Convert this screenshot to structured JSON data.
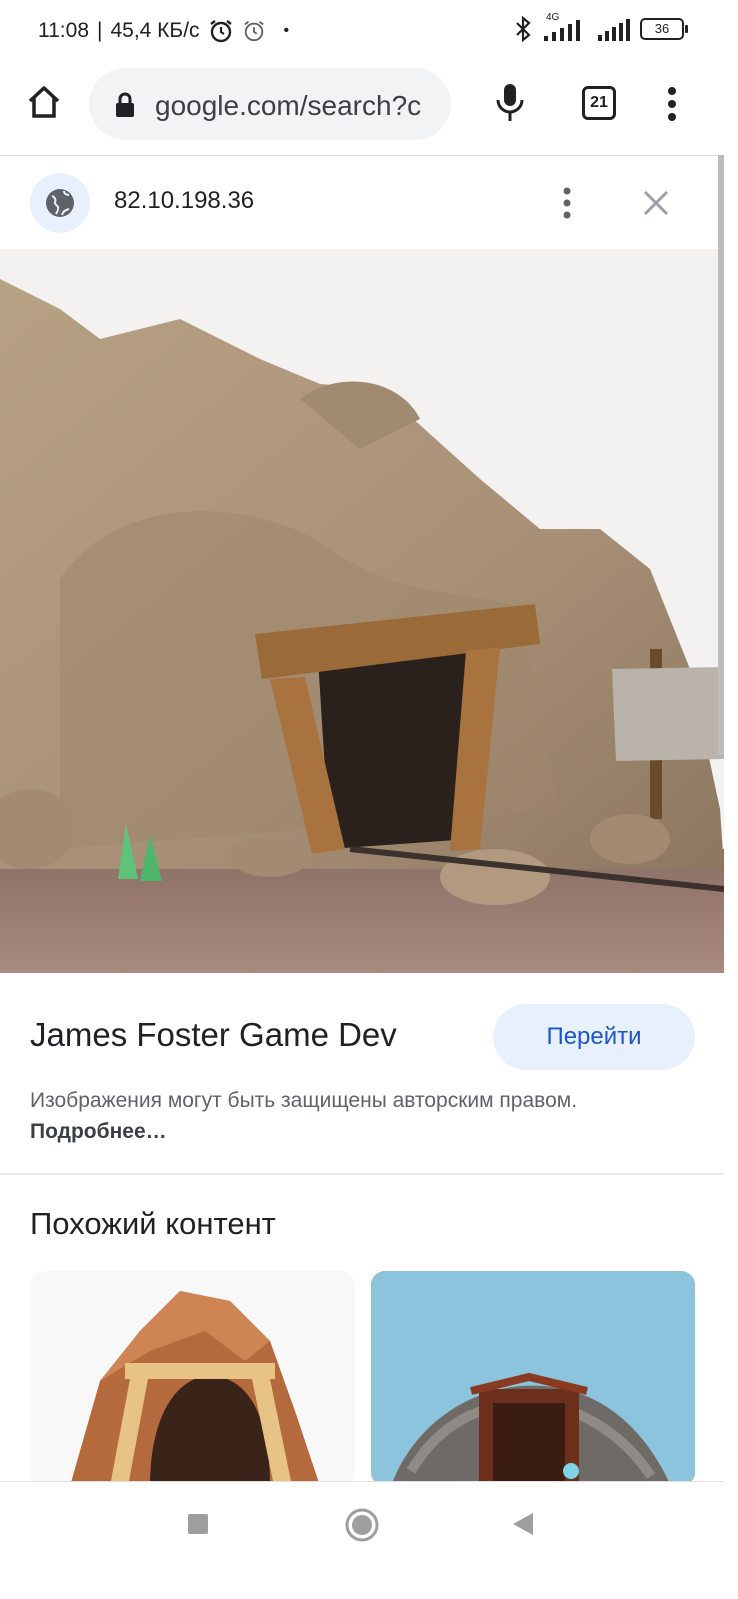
{
  "status_bar": {
    "time": "11:08",
    "separator": "|",
    "speed": "45,4 КБ/с",
    "dot": "•",
    "network": "4G",
    "battery": "36"
  },
  "toolbar": {
    "url": "google.com/search?c",
    "tab_count": "21"
  },
  "site_bar": {
    "address": "82.10.198.36"
  },
  "result": {
    "source_name": "James Foster Game Dev",
    "visit_label": "Перейти",
    "copyright_text": "Изображения могут быть защищены авторским правом.",
    "more_link": "Подробнее…"
  },
  "similar": {
    "title": "Похожий контент"
  },
  "colors": {
    "accent": "#1a56c5",
    "pill": "#e8f0fe",
    "url_bg": "#f1f3f4"
  },
  "icons": [
    "home-icon",
    "lock-icon",
    "mic-icon",
    "tabs-icon",
    "more-vert-icon",
    "globe-icon",
    "close-icon",
    "bluetooth-icon",
    "alarm-icon",
    "signal-icon",
    "battery-icon",
    "nav-recents-icon",
    "nav-home-icon",
    "nav-back-icon"
  ]
}
